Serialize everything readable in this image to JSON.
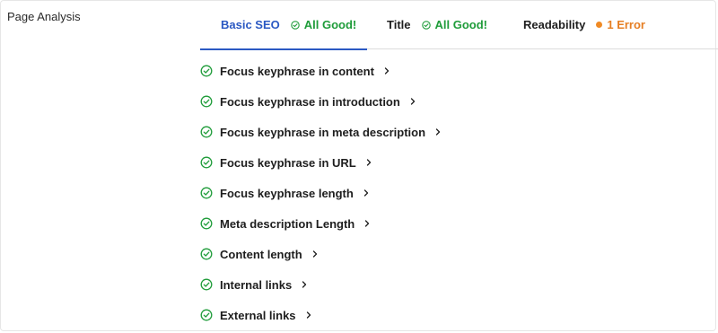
{
  "section": {
    "label": "Page Analysis"
  },
  "tabs": [
    {
      "label": "Basic SEO",
      "status": "All Good!",
      "status_type": "good",
      "active": true
    },
    {
      "label": "Title",
      "status": "All Good!",
      "status_type": "good",
      "active": false
    },
    {
      "label": "Readability",
      "status": "1 Error",
      "status_type": "error",
      "active": false
    }
  ],
  "checks": [
    {
      "label": "Focus keyphrase in content",
      "icon": "check-circle-icon"
    },
    {
      "label": "Focus keyphrase in introduction",
      "icon": "check-circle-icon"
    },
    {
      "label": "Focus keyphrase in meta description",
      "icon": "check-circle-icon"
    },
    {
      "label": "Focus keyphrase in URL",
      "icon": "check-circle-icon"
    },
    {
      "label": "Focus keyphrase length",
      "icon": "check-circle-icon"
    },
    {
      "label": "Meta description Length",
      "icon": "check-circle-icon"
    },
    {
      "label": "Content length",
      "icon": "check-circle-icon"
    },
    {
      "label": "Internal links",
      "icon": "check-circle-icon"
    },
    {
      "label": "External links",
      "icon": "check-circle-icon"
    }
  ],
  "colors": {
    "accent": "#2b59c3",
    "good": "#1f9c3a",
    "error": "#e67e22"
  }
}
